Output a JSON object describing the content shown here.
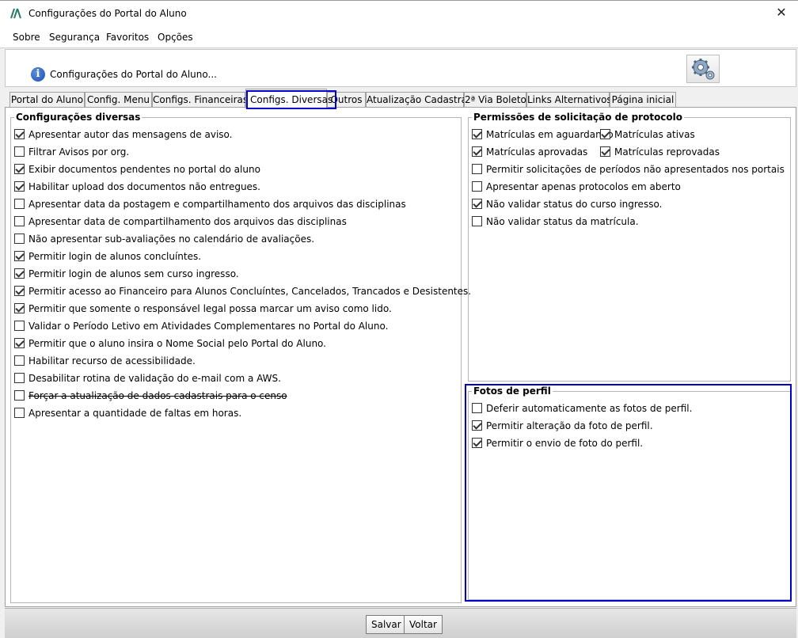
{
  "window": {
    "title": "Configurações do Portal do Aluno",
    "close_glyph": "✕"
  },
  "menu": [
    "Sobre",
    "Segurança",
    "Favoritos",
    "Opções"
  ],
  "header": {
    "text": "Configurações do Portal do Aluno...",
    "info_glyph": "i",
    "icons": [
      "info-icon",
      "gear-icon"
    ]
  },
  "tabs": [
    "Portal do Aluno",
    "Config. Menu",
    "Configs. Financeiras",
    "Configs. Diversas",
    "Outros",
    "Atualização Cadastral",
    "2ª Via Boleto",
    "Links Alternativos",
    "Página inicial"
  ],
  "active_tab": "Configs. Diversas",
  "configuracoes_diversas": {
    "title": "Configurações diversas",
    "items": [
      {
        "label": "Apresentar autor das mensagens de aviso.",
        "checked": true
      },
      {
        "label": "Filtrar Avisos por org.",
        "checked": false
      },
      {
        "label": "Exibir documentos pendentes no portal do aluno",
        "checked": true
      },
      {
        "label": "Habilitar upload dos documentos não entregues.",
        "checked": true
      },
      {
        "label": "Apresentar data da postagem e compartilhamento dos arquivos das disciplinas",
        "checked": false
      },
      {
        "label": "Apresentar data de compartilhamento dos arquivos das disciplinas",
        "checked": false
      },
      {
        "label": "Não apresentar sub-avaliações no calendário de avaliações.",
        "checked": false
      },
      {
        "label": "Permitir login de alunos concluíntes.",
        "checked": true
      },
      {
        "label": "Permitir login de alunos sem curso ingresso.",
        "checked": true
      },
      {
        "label": "Permitir acesso ao Financeiro para Alunos Concluíntes, Cancelados, Trancados e Desistentes.",
        "checked": true
      },
      {
        "label": "Permitir que somente o responsável legal possa marcar um aviso como lido.",
        "checked": true
      },
      {
        "label": "Validar o Período Letivo em Atividades Complementares no Portal do Aluno.",
        "checked": false
      },
      {
        "label": "Permitir que o aluno insira o Nome Social pelo Portal do Aluno.",
        "checked": true
      },
      {
        "label": "Habilitar recurso de acessibilidade.",
        "checked": false
      },
      {
        "label": "Desabilitar rotina de validação do e-mail com a AWS.",
        "checked": false
      },
      {
        "label": "Forçar a atualização de dados cadastrais para o censo",
        "checked": false,
        "strikethrough": true
      },
      {
        "label": "Apresentar a quantidade de faltas em horas.",
        "checked": false
      }
    ]
  },
  "permissoes": {
    "title": "Permissões de solicitação de protocolo",
    "items": [
      {
        "label": "Matrículas em aguardando",
        "checked": true
      },
      {
        "label": "Matrículas ativas",
        "checked": true
      },
      {
        "label": "Matrículas aprovadas",
        "checked": true
      },
      {
        "label": "Matrículas reprovadas",
        "checked": true
      },
      {
        "label": "Permitir solicitações de períodos não apresentados nos portais",
        "checked": false
      },
      {
        "label": "Apresentar apenas protocolos em aberto",
        "checked": false
      },
      {
        "label": "Não validar status do curso ingresso.",
        "checked": true
      },
      {
        "label": "Não validar status da matrícula.",
        "checked": false
      }
    ]
  },
  "fotos_perfil": {
    "title": "Fotos de perfil",
    "items": [
      {
        "label": "Deferir automaticamente as fotos de perfil.",
        "checked": false
      },
      {
        "label": "Permitir alteração da foto de perfil.",
        "checked": true
      },
      {
        "label": "Permitir o envio de foto do perfil.",
        "checked": true
      }
    ]
  },
  "footer": {
    "save_label": "Salvar",
    "back_label": "Voltar"
  },
  "colors": {
    "highlight": "#0000cc",
    "info_icon": "#1a4fb0",
    "app_icon": "#2a7a6a"
  }
}
